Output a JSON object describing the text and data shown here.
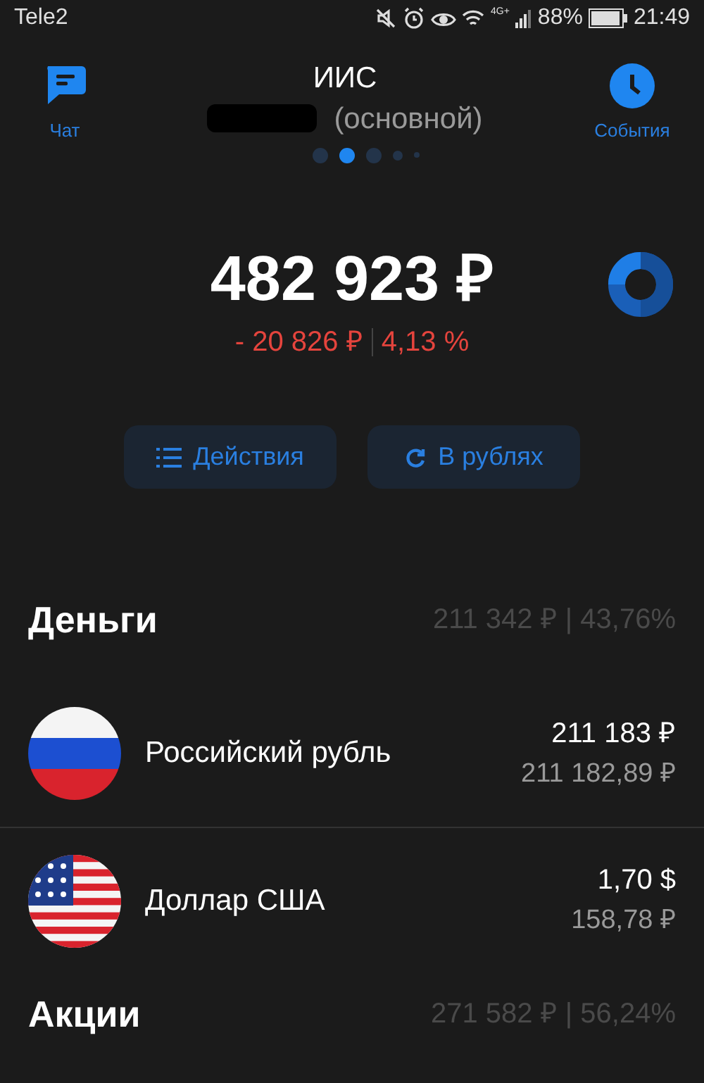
{
  "status_bar": {
    "carrier": "Tele2",
    "network": "4G+",
    "battery": "88%",
    "time": "21:49"
  },
  "header": {
    "left_action": "Чат",
    "title": "ИИС",
    "subtitle": "(основной)",
    "right_action": "События"
  },
  "pager": [
    {
      "selected": false
    },
    {
      "selected": true
    },
    {
      "selected": false
    },
    {
      "selected": false
    },
    {
      "selected": false
    }
  ],
  "portfolio": {
    "total": "482 923 ₽",
    "change": "- 20 826 ₽",
    "change_percent": "4,13 %"
  },
  "buttons": [
    {
      "kind": "list",
      "label": "Действия"
    },
    {
      "kind": "refresh",
      "label": "В рублях"
    }
  ],
  "sections": [
    {
      "title": "Деньги",
      "summary": "211 342 ₽ | 43,76%",
      "items": [
        {
          "kind": "ru",
          "name": "Российский рубль",
          "amount": "211 183 ₽",
          "value": "211 182,89 ₽"
        },
        {
          "kind": "us",
          "name": "Доллар США",
          "amount": "1,70 $",
          "value": "158,78 ₽"
        }
      ]
    },
    {
      "title": "Акции",
      "summary": "271 582 ₽ | 56,24%"
    }
  ]
}
